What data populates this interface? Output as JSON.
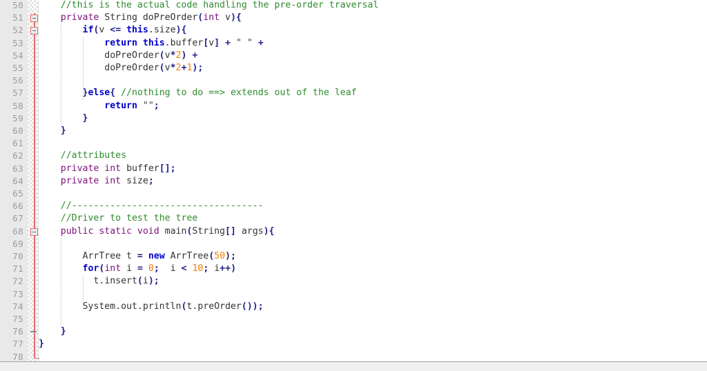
{
  "editor": {
    "language": "java",
    "first_visible_line": 50,
    "last_visible_line": 78,
    "line_height_px": 18.2,
    "colors": {
      "background": "#ffffff",
      "gutter_background": "#e9e9e9",
      "line_number": "#9b9b9b",
      "keyword_type": "#7f0f7f",
      "keyword_control": "#0000cc",
      "punctuation": "#20208a",
      "comment": "#2e8b2e",
      "number": "#f08000",
      "string": "#444444",
      "identifier": "#333333",
      "scope_bar": "#e06c6c",
      "indent_guide": "#c0c0c0"
    }
  },
  "gutter": {
    "line_numbers": [
      "50",
      "51",
      "52",
      "53",
      "54",
      "55",
      "56",
      "57",
      "58",
      "59",
      "60",
      "61",
      "62",
      "63",
      "64",
      "65",
      "66",
      "67",
      "68",
      "69",
      "70",
      "71",
      "72",
      "73",
      "74",
      "75",
      "76",
      "77",
      "78"
    ]
  },
  "fold_markers": [
    {
      "line": 51,
      "type": "collapse-box"
    },
    {
      "line": 52,
      "type": "collapse-box"
    },
    {
      "line": 68,
      "type": "collapse-box"
    },
    {
      "line": 76,
      "type": "fold-end-dash"
    }
  ],
  "code": {
    "lines": [
      {
        "number": 50,
        "text": "    //this is the actual code handling the pre-order traversal",
        "tokens": [
          {
            "t": "    ",
            "c": "id"
          },
          {
            "t": "//this is the actual code handling the pre-order traversal",
            "c": "cmt"
          }
        ]
      },
      {
        "number": 51,
        "text": "    private String doPreOrder(int v){",
        "tokens": [
          {
            "t": "    ",
            "c": "id"
          },
          {
            "t": "private",
            "c": "kw"
          },
          {
            "t": " String doPreOrder",
            "c": "id"
          },
          {
            "t": "(",
            "c": "punc"
          },
          {
            "t": "int",
            "c": "kw"
          },
          {
            "t": " v",
            "c": "id"
          },
          {
            "t": "){",
            "c": "punc"
          }
        ]
      },
      {
        "number": 52,
        "text": "        if(v <= this.size){",
        "tokens": [
          {
            "t": "        ",
            "c": "id"
          },
          {
            "t": "if",
            "c": "kwb"
          },
          {
            "t": "(",
            "c": "punc"
          },
          {
            "t": "v ",
            "c": "id"
          },
          {
            "t": "<=",
            "c": "op"
          },
          {
            "t": " ",
            "c": "id"
          },
          {
            "t": "this",
            "c": "kwb"
          },
          {
            "t": ".size",
            "c": "id"
          },
          {
            "t": "){",
            "c": "punc"
          }
        ]
      },
      {
        "number": 53,
        "text": "            return this.buffer[v] + \" \" +",
        "tokens": [
          {
            "t": "            ",
            "c": "id"
          },
          {
            "t": "return",
            "c": "kwb"
          },
          {
            "t": " ",
            "c": "id"
          },
          {
            "t": "this",
            "c": "kwb"
          },
          {
            "t": ".buffer",
            "c": "id"
          },
          {
            "t": "[",
            "c": "punc"
          },
          {
            "t": "v",
            "c": "id"
          },
          {
            "t": "]",
            "c": "punc"
          },
          {
            "t": " ",
            "c": "id"
          },
          {
            "t": "+",
            "c": "punc"
          },
          {
            "t": " ",
            "c": "id"
          },
          {
            "t": "\" \"",
            "c": "str"
          },
          {
            "t": " ",
            "c": "id"
          },
          {
            "t": "+",
            "c": "punc"
          }
        ]
      },
      {
        "number": 54,
        "text": "            doPreOrder(v*2) +",
        "tokens": [
          {
            "t": "            doPreOrder",
            "c": "id"
          },
          {
            "t": "(",
            "c": "punc"
          },
          {
            "t": "v",
            "c": "id"
          },
          {
            "t": "*",
            "c": "punc"
          },
          {
            "t": "2",
            "c": "num"
          },
          {
            "t": ")",
            "c": "punc"
          },
          {
            "t": " ",
            "c": "id"
          },
          {
            "t": "+",
            "c": "punc"
          }
        ]
      },
      {
        "number": 55,
        "text": "            doPreOrder(v*2+1);",
        "tokens": [
          {
            "t": "            doPreOrder",
            "c": "id"
          },
          {
            "t": "(",
            "c": "punc"
          },
          {
            "t": "v",
            "c": "id"
          },
          {
            "t": "*",
            "c": "punc"
          },
          {
            "t": "2",
            "c": "num"
          },
          {
            "t": "+",
            "c": "punc"
          },
          {
            "t": "1",
            "c": "num"
          },
          {
            "t": ");",
            "c": "punc"
          }
        ]
      },
      {
        "number": 56,
        "text": "",
        "tokens": []
      },
      {
        "number": 57,
        "text": "        }else{ //nothing to do ==> extends out of the leaf",
        "tokens": [
          {
            "t": "        ",
            "c": "id"
          },
          {
            "t": "}",
            "c": "punc"
          },
          {
            "t": "else",
            "c": "kwb"
          },
          {
            "t": "{",
            "c": "punc"
          },
          {
            "t": " ",
            "c": "id"
          },
          {
            "t": "//nothing to do ==> extends out of the leaf",
            "c": "cmt"
          }
        ]
      },
      {
        "number": 58,
        "text": "            return \"\";",
        "tokens": [
          {
            "t": "            ",
            "c": "id"
          },
          {
            "t": "return",
            "c": "kwb"
          },
          {
            "t": " ",
            "c": "id"
          },
          {
            "t": "\"\"",
            "c": "str"
          },
          {
            "t": ";",
            "c": "punc"
          }
        ]
      },
      {
        "number": 59,
        "text": "        }",
        "tokens": [
          {
            "t": "        ",
            "c": "id"
          },
          {
            "t": "}",
            "c": "punc"
          }
        ]
      },
      {
        "number": 60,
        "text": "    }",
        "tokens": [
          {
            "t": "    ",
            "c": "id"
          },
          {
            "t": "}",
            "c": "punc"
          }
        ]
      },
      {
        "number": 61,
        "text": "",
        "tokens": []
      },
      {
        "number": 62,
        "text": "    //attributes",
        "tokens": [
          {
            "t": "    ",
            "c": "id"
          },
          {
            "t": "//attributes",
            "c": "cmt"
          }
        ]
      },
      {
        "number": 63,
        "text": "    private int buffer[];",
        "tokens": [
          {
            "t": "    ",
            "c": "id"
          },
          {
            "t": "private",
            "c": "kw"
          },
          {
            "t": " ",
            "c": "id"
          },
          {
            "t": "int",
            "c": "kw"
          },
          {
            "t": " buffer",
            "c": "id"
          },
          {
            "t": "[];",
            "c": "punc"
          }
        ]
      },
      {
        "number": 64,
        "text": "    private int size;",
        "tokens": [
          {
            "t": "    ",
            "c": "id"
          },
          {
            "t": "private",
            "c": "kw"
          },
          {
            "t": " ",
            "c": "id"
          },
          {
            "t": "int",
            "c": "kw"
          },
          {
            "t": " size",
            "c": "id"
          },
          {
            "t": ";",
            "c": "punc"
          }
        ]
      },
      {
        "number": 65,
        "text": "",
        "tokens": []
      },
      {
        "number": 66,
        "text": "    //-----------------------------------",
        "tokens": [
          {
            "t": "    ",
            "c": "id"
          },
          {
            "t": "//-----------------------------------",
            "c": "cmt"
          }
        ]
      },
      {
        "number": 67,
        "text": "    //Driver to test the tree",
        "tokens": [
          {
            "t": "    ",
            "c": "id"
          },
          {
            "t": "//Driver to test the tree",
            "c": "cmt"
          }
        ]
      },
      {
        "number": 68,
        "text": "    public static void main(String[] args){",
        "tokens": [
          {
            "t": "    ",
            "c": "id"
          },
          {
            "t": "public static void",
            "c": "kw"
          },
          {
            "t": " main",
            "c": "id"
          },
          {
            "t": "(",
            "c": "punc"
          },
          {
            "t": "String",
            "c": "id"
          },
          {
            "t": "[]",
            "c": "punc"
          },
          {
            "t": " args",
            "c": "id"
          },
          {
            "t": "){",
            "c": "punc"
          }
        ]
      },
      {
        "number": 69,
        "text": "",
        "tokens": []
      },
      {
        "number": 70,
        "text": "        ArrTree t = new ArrTree(50);",
        "tokens": [
          {
            "t": "        ArrTree t ",
            "c": "id"
          },
          {
            "t": "=",
            "c": "punc"
          },
          {
            "t": " ",
            "c": "id"
          },
          {
            "t": "new",
            "c": "kwb"
          },
          {
            "t": " ArrTree",
            "c": "id"
          },
          {
            "t": "(",
            "c": "punc"
          },
          {
            "t": "50",
            "c": "num"
          },
          {
            "t": ");",
            "c": "punc"
          }
        ]
      },
      {
        "number": 71,
        "text": "        for(int i = 0;  i < 10; i++)",
        "tokens": [
          {
            "t": "        ",
            "c": "id"
          },
          {
            "t": "for",
            "c": "kwb"
          },
          {
            "t": "(",
            "c": "punc"
          },
          {
            "t": "int",
            "c": "kw"
          },
          {
            "t": " i ",
            "c": "id"
          },
          {
            "t": "=",
            "c": "punc"
          },
          {
            "t": " ",
            "c": "id"
          },
          {
            "t": "0",
            "c": "num"
          },
          {
            "t": ";",
            "c": "punc"
          },
          {
            "t": "  i ",
            "c": "id"
          },
          {
            "t": "<",
            "c": "punc"
          },
          {
            "t": " ",
            "c": "id"
          },
          {
            "t": "10",
            "c": "num"
          },
          {
            "t": ";",
            "c": "punc"
          },
          {
            "t": " i",
            "c": "id"
          },
          {
            "t": "++)",
            "c": "punc"
          }
        ]
      },
      {
        "number": 72,
        "text": "          t.insert(i);",
        "tokens": [
          {
            "t": "          t.insert",
            "c": "id"
          },
          {
            "t": "(",
            "c": "punc"
          },
          {
            "t": "i",
            "c": "id"
          },
          {
            "t": ");",
            "c": "punc"
          }
        ]
      },
      {
        "number": 73,
        "text": "",
        "tokens": []
      },
      {
        "number": 74,
        "text": "        System.out.println(t.preOrder());",
        "tokens": [
          {
            "t": "        System.out.println",
            "c": "id"
          },
          {
            "t": "(",
            "c": "punc"
          },
          {
            "t": "t.preOrder",
            "c": "id"
          },
          {
            "t": "());",
            "c": "punc"
          }
        ]
      },
      {
        "number": 75,
        "text": "",
        "tokens": []
      },
      {
        "number": 76,
        "text": "    }",
        "tokens": [
          {
            "t": "    ",
            "c": "id"
          },
          {
            "t": "}",
            "c": "punc"
          }
        ]
      },
      {
        "number": 77,
        "text": "}",
        "tokens": [
          {
            "t": "}",
            "c": "punc"
          }
        ]
      },
      {
        "number": 78,
        "text": "",
        "tokens": []
      }
    ]
  },
  "indent_guides": [
    {
      "column": 4,
      "from_line": 52,
      "to_line": 59
    },
    {
      "column": 8,
      "from_line": 53,
      "to_line": 57
    },
    {
      "column": 4,
      "from_line": 69,
      "to_line": 75
    },
    {
      "column": 8,
      "from_line": 72,
      "to_line": 73
    }
  ]
}
